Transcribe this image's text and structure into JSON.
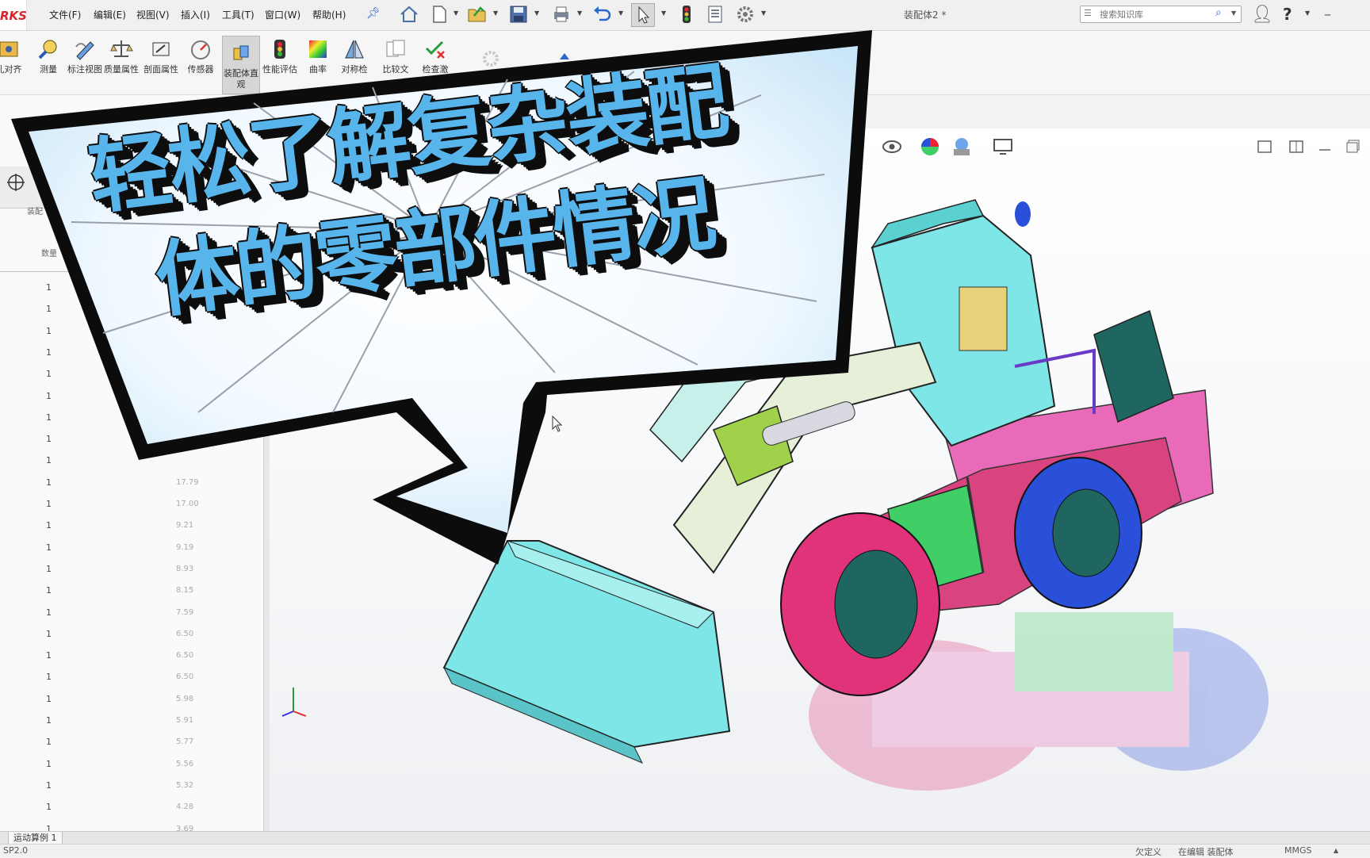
{
  "app": {
    "logo_text": "RKS",
    "document_title": "装配体2 *"
  },
  "menu": {
    "items": [
      "文件(F)",
      "编辑(E)",
      "视图(V)",
      "插入(I)",
      "工具(T)",
      "窗口(W)",
      "帮助(H)"
    ]
  },
  "quick_access": {
    "icons": [
      "home-icon",
      "new-document-icon",
      "open-icon",
      "save-icon",
      "print-icon",
      "undo-icon",
      "select-pointer-icon",
      "traffic-light-icon",
      "file-properties-icon",
      "options-gear-icon"
    ]
  },
  "search": {
    "placeholder": "搜索知识库"
  },
  "command_manager": {
    "buttons": [
      {
        "label": "孔对齐",
        "icon": "hole-alignment-icon"
      },
      {
        "label": "测量",
        "icon": "measure-icon"
      },
      {
        "label": "标注视图",
        "icon": "markup-view-icon"
      },
      {
        "label": "质量属性",
        "icon": "mass-properties-icon"
      },
      {
        "label": "剖面属性",
        "icon": "section-properties-icon"
      },
      {
        "label": "传感器",
        "icon": "sensor-icon"
      },
      {
        "label": "装配体直观",
        "icon": "assembly-visualization-icon",
        "active": true
      },
      {
        "label": "性能评估",
        "icon": "performance-evaluation-icon"
      },
      {
        "label": "曲率",
        "icon": "curvature-icon"
      },
      {
        "label": "对称检",
        "icon": "symmetry-check-icon"
      },
      {
        "label": "比较文",
        "icon": "compare-documents-icon"
      },
      {
        "label": "检查激",
        "icon": "check-active-icon"
      }
    ]
  },
  "left_panel": {
    "header_label": "装配",
    "column_header": "数量",
    "rows": [
      {
        "qty": "1",
        "value": ""
      },
      {
        "qty": "1",
        "value": ""
      },
      {
        "qty": "1",
        "value": ""
      },
      {
        "qty": "1",
        "value": ""
      },
      {
        "qty": "1",
        "value": ""
      },
      {
        "qty": "1",
        "value": ""
      },
      {
        "qty": "1",
        "value": ""
      },
      {
        "qty": "1",
        "value": ""
      },
      {
        "qty": "1",
        "value": ""
      },
      {
        "qty": "1",
        "value": "17.79"
      },
      {
        "qty": "1",
        "value": "17.00"
      },
      {
        "qty": "1",
        "value": "9.21"
      },
      {
        "qty": "1",
        "value": "9.19"
      },
      {
        "qty": "1",
        "value": "8.93"
      },
      {
        "qty": "1",
        "value": "8.15"
      },
      {
        "qty": "1",
        "value": "7.59"
      },
      {
        "qty": "1",
        "value": "6.50"
      },
      {
        "qty": "1",
        "value": "6.50"
      },
      {
        "qty": "1",
        "value": "6.50"
      },
      {
        "qty": "1",
        "value": "5.98"
      },
      {
        "qty": "1",
        "value": "5.91"
      },
      {
        "qty": "1",
        "value": "5.77"
      },
      {
        "qty": "1",
        "value": "5.56"
      },
      {
        "qty": "1",
        "value": "5.32"
      },
      {
        "qty": "1",
        "value": "4.28"
      },
      {
        "qty": "1",
        "value": "3.69"
      }
    ]
  },
  "bottom_tabs": {
    "motion_study": "运动算例 1"
  },
  "status_bar": {
    "version": "SP2.0",
    "definition": "欠定义",
    "editing": "在编辑 装配体",
    "units": "MMGS"
  },
  "overlay": {
    "line1": "轻松了解复杂装配",
    "line2": "体的零部件情况",
    "text_color": "#58b5ec",
    "outline_color": "#0d0d0d"
  },
  "model": {
    "description_colors": [
      "#7ee6e6",
      "#e0337a",
      "#2a4fd8",
      "#3fcf66",
      "#e8d27a",
      "#e6f0d8"
    ]
  }
}
